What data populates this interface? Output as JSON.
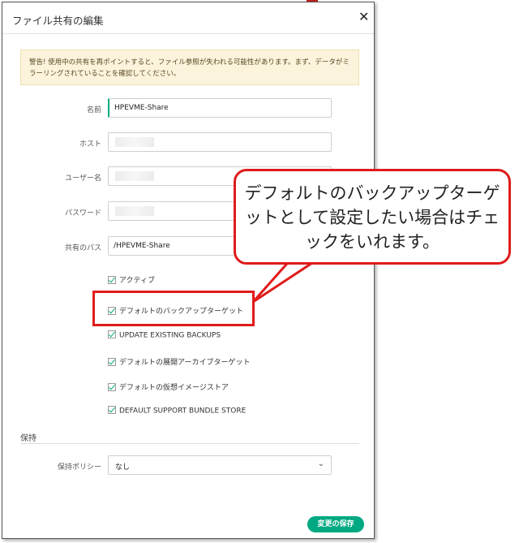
{
  "dialog": {
    "title": "ファイル共有の編集",
    "close_label": "✕",
    "warning": "警告! 使用中の共有を再ポイントすると、ファイル参照が失われる可能性があります。まず、データがミラーリングされていることを確認してください。"
  },
  "form": {
    "name_label": "名前",
    "name_value": "HPEVME-Share",
    "host_label": "ホスト",
    "user_label": "ユーザー名",
    "password_label": "パスワード",
    "share_path_label": "共有のパス",
    "share_path_value": "/HPEVME-Share"
  },
  "checkboxes": [
    {
      "label": "アクティブ",
      "checked": true
    },
    {
      "label": "デフォルトのバックアップターゲット",
      "checked": true
    },
    {
      "label": "UPDATE EXISTING BACKUPS",
      "checked": true
    },
    {
      "label": "デフォルトの展開アーカイブターゲット",
      "checked": true
    },
    {
      "label": "デフォルトの仮想イメージストア",
      "checked": true
    },
    {
      "label": "DEFAULT SUPPORT BUNDLE STORE",
      "checked": true
    }
  ],
  "retention": {
    "section_title": "保持",
    "policy_label": "保持ポリシー",
    "policy_value": "なし"
  },
  "save_label": "変更の保存",
  "callout_text": "デフォルトのバックアップターゲットとして設定したい場合はチェックをいれます。",
  "colors": {
    "accent": "#01a982",
    "highlight": "#e01b1b",
    "warning_bg": "#fbf3dc"
  }
}
